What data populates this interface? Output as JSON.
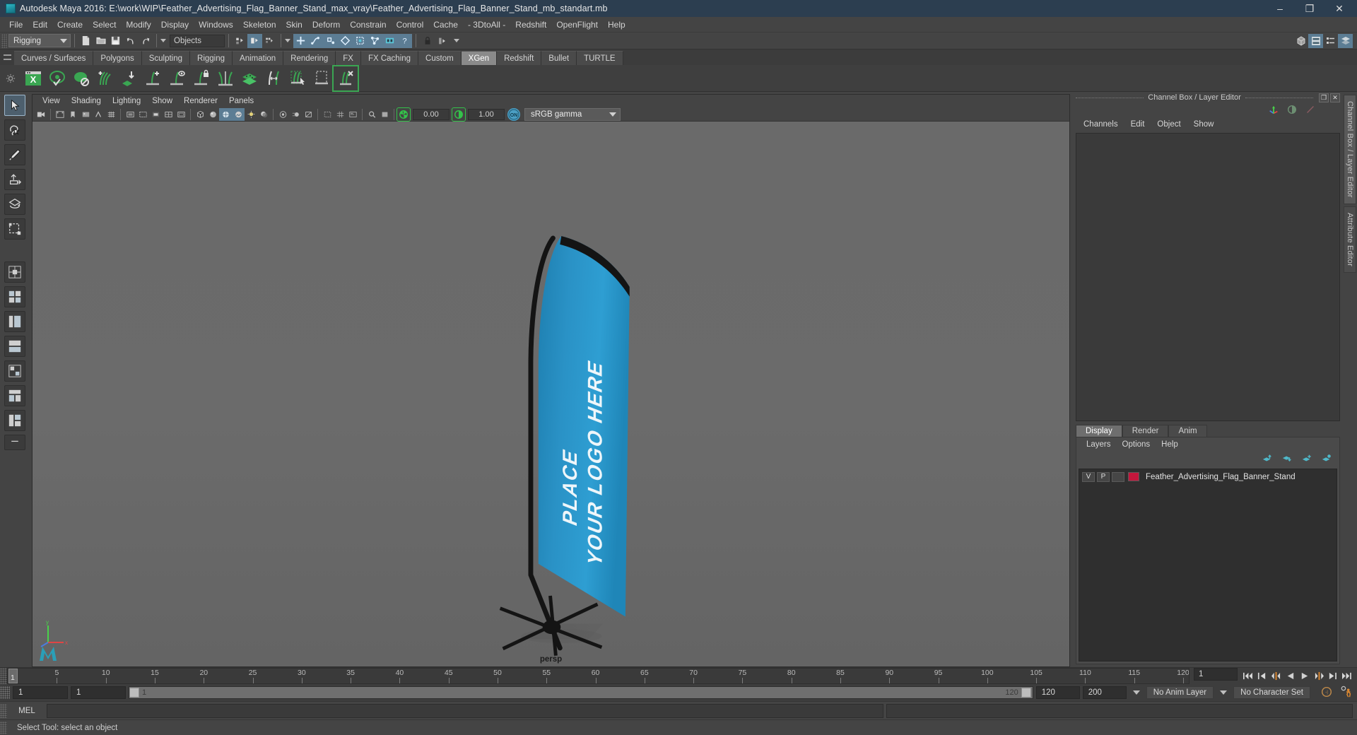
{
  "window": {
    "title": "Autodesk Maya 2016: E:\\work\\WIP\\Feather_Advertising_Flag_Banner_Stand_max_vray\\Feather_Advertising_Flag_Banner_Stand_mb_standart.mb",
    "minimize": "–",
    "maximize": "❐",
    "close": "✕"
  },
  "menubar": {
    "items": [
      {
        "label": "File"
      },
      {
        "label": "Edit"
      },
      {
        "label": "Create"
      },
      {
        "label": "Select"
      },
      {
        "label": "Modify"
      },
      {
        "label": "Display"
      },
      {
        "label": "Windows"
      },
      {
        "label": "Skeleton"
      },
      {
        "label": "Skin"
      },
      {
        "label": "Deform"
      },
      {
        "label": "Constrain"
      },
      {
        "label": "Control"
      },
      {
        "label": "Cache"
      },
      {
        "label": "- 3DtoAll -"
      },
      {
        "label": "Redshift"
      },
      {
        "label": "OpenFlight"
      },
      {
        "label": "Help"
      }
    ]
  },
  "statusline": {
    "menuset": "Rigging",
    "selection_mask_value": "Objects",
    "icons": [
      "new-scene-icon",
      "open-scene-icon",
      "save-scene-icon",
      "undo-icon",
      "redo-icon",
      "select-hierarchy-icon",
      "select-object-icon",
      "select-component-icon",
      "snap-grid-icon",
      "snap-curve-icon",
      "snap-point-icon",
      "snap-projected-center-icon",
      "snap-view-plane-icon",
      "make-live-icon",
      "construction-history-icon",
      "help-icon",
      "lock-icon",
      "render-current-frame-icon",
      "show-hide-modeling-toolkit-icon",
      "show-hide-attribute-editor-icon",
      "show-hide-tool-settings-icon",
      "show-hide-channel-box-icon"
    ]
  },
  "shelf": {
    "tabs": [
      {
        "label": "Curves / Surfaces",
        "active": false
      },
      {
        "label": "Polygons",
        "active": false
      },
      {
        "label": "Sculpting",
        "active": false
      },
      {
        "label": "Rigging",
        "active": false
      },
      {
        "label": "Animation",
        "active": false
      },
      {
        "label": "Rendering",
        "active": false
      },
      {
        "label": "FX",
        "active": false
      },
      {
        "label": "FX Caching",
        "active": false
      },
      {
        "label": "Custom",
        "active": false
      },
      {
        "label": "XGen",
        "active": true
      },
      {
        "label": "Redshift",
        "active": false
      },
      {
        "label": "Bullet",
        "active": false
      },
      {
        "label": "TURTLE",
        "active": false
      }
    ],
    "buttons": [
      "xgen-editor-icon",
      "xgen-preview-icon",
      "xgen-create-description-icon",
      "xgen-add-grooming-icon",
      "xgen-import-collection-icon",
      "xgen-add-guide-icon",
      "xgen-guide-display-icon",
      "xgen-lock-guide-icon",
      "xgen-part-guides-icon",
      "xgen-density-icon",
      "xgen-length-tool-icon",
      "xgen-select-guides-icon",
      "xgen-region-select-icon",
      "xgen-delete-guide-icon"
    ]
  },
  "toolbox": {
    "tools": [
      {
        "name": "select-tool",
        "selected": true
      },
      {
        "name": "lasso-select-tool",
        "selected": false
      },
      {
        "name": "paint-select-tool",
        "selected": false
      },
      {
        "name": "move-tool",
        "selected": false
      },
      {
        "name": "rotate-tool",
        "selected": false
      },
      {
        "name": "scale-tool",
        "selected": false
      }
    ],
    "layouts": [
      "single-perspective-layout",
      "four-view-layout",
      "outliner-persp-layout",
      "persp-graph-layout",
      "hypershade-persp-layout",
      "persp-hypergraph-layout",
      "outliner-persp-graph-layout",
      "more-layouts"
    ]
  },
  "viewport": {
    "menus": [
      {
        "label": "View"
      },
      {
        "label": "Shading"
      },
      {
        "label": "Lighting"
      },
      {
        "label": "Show"
      },
      {
        "label": "Renderer"
      },
      {
        "label": "Panels"
      }
    ],
    "camera_label": "persp",
    "exposure_value": "0.00",
    "gamma_value": "1.00",
    "color_management": "sRGB gamma",
    "color_management_enabled": "ON",
    "icons": [
      "select-camera-icon",
      "playblast-icon",
      "bookmark-icon",
      "image-plane-icon",
      "grid-toggle-icon",
      "film-gate-icon",
      "resolution-gate-icon",
      "gate-mask-icon",
      "field-chart-icon",
      "safe-action-icon",
      "safe-title-icon",
      "xray-toggle-icon",
      "xray-joints-icon",
      "wireframe-shaded-icon",
      "smooth-shade-all-icon",
      "shaded-wireframe-icon",
      "textured-icon",
      "use-all-lights-icon",
      "shadows-icon",
      "ambient-occlusion-icon",
      "motion-blur-icon",
      "multisample-icon",
      "isolate-select-icon",
      "grid-icon",
      "hud-icon",
      "2d-pan-zoom-icon",
      "gpu-cache-icon",
      "exposure-icon",
      "gamma-icon"
    ],
    "scene": {
      "object_name": "Feather Advertising Flag Banner Stand",
      "flag_text_line1": "PLACE",
      "flag_text_line2": "YOUR LOGO HERE",
      "flag_color": "#2b8fc4",
      "pole_color": "#1a1a1a",
      "background_color": "#6a6a6a"
    }
  },
  "channel_box": {
    "panel_title": "Channel Box / Layer Editor",
    "restore_glyph": "❐",
    "close_glyph": "✕",
    "menus": [
      {
        "label": "Channels"
      },
      {
        "label": "Edit"
      },
      {
        "label": "Object"
      },
      {
        "label": "Show"
      }
    ],
    "toolbar_icons": [
      "channel-box-icon",
      "layer-editor-icon",
      "attribute-editor-icon"
    ]
  },
  "layer_editor": {
    "tabs": [
      {
        "label": "Display",
        "active": true
      },
      {
        "label": "Render",
        "active": false
      },
      {
        "label": "Anim",
        "active": false
      }
    ],
    "menus": [
      {
        "label": "Layers"
      },
      {
        "label": "Options"
      },
      {
        "label": "Help"
      }
    ],
    "buttons": [
      "move-layer-up-icon",
      "move-layer-down-icon",
      "new-layer-icon",
      "new-layer-from-selected-icon"
    ],
    "layers": [
      {
        "visibility": "V",
        "playback": "P",
        "display_type": "",
        "color": "#c4173c",
        "name": "Feather_Advertising_Flag_Banner_Stand"
      }
    ]
  },
  "right_sidebar": {
    "tabs": [
      {
        "label": "Channel Box / Layer Editor",
        "active": true
      },
      {
        "label": "Attribute Editor",
        "active": false
      }
    ]
  },
  "timeline": {
    "start": 1,
    "end": 120,
    "current_frame": "1",
    "tick_labels": [
      5,
      10,
      15,
      20,
      25,
      30,
      35,
      40,
      45,
      50,
      55,
      60,
      65,
      70,
      75,
      80,
      85,
      90,
      95,
      100,
      105,
      110,
      115,
      120
    ],
    "playhead_label": "1",
    "playback_buttons": [
      "go-to-start-icon",
      "step-back-keyframe-icon",
      "step-back-frame-icon",
      "play-backwards-icon",
      "play-forwards-icon",
      "step-forward-frame-icon",
      "step-forward-keyframe-icon",
      "go-to-end-icon"
    ]
  },
  "range_slider": {
    "anim_start": "1",
    "range_start": "1",
    "bar_start_label": "1",
    "bar_end_label": "120",
    "range_end": "120",
    "anim_end": "200",
    "anim_layer": "No Anim Layer",
    "character_set": "No Character Set",
    "icons": [
      "auto-keyframe-icon",
      "animation-preferences-icon"
    ]
  },
  "command_line": {
    "language": "MEL",
    "input_value": "",
    "output_value": ""
  },
  "help_line": {
    "message": "Select Tool: select an object"
  }
}
